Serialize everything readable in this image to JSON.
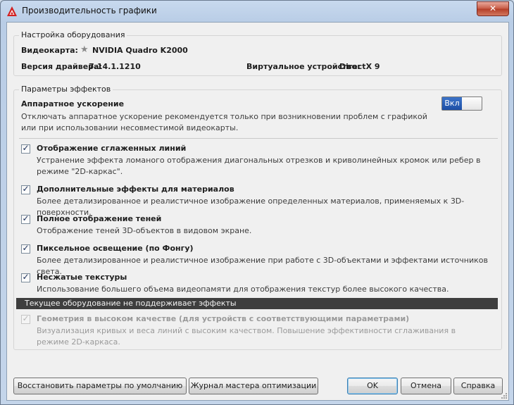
{
  "window": {
    "title": "Производительность графики",
    "close_label": "✕"
  },
  "hardware": {
    "legend": "Настройка оборудования",
    "card_label": "Видеокарта:",
    "card_value": "NVIDIA Quadro K2000",
    "driver_label": "Версия драйвера:",
    "driver_value": "7.14.1.1210",
    "device_label": "Виртуальное устройство:",
    "device_value": "DirectX 9"
  },
  "effects": {
    "legend": "Параметры эффектов",
    "hw_accel_title": "Аппаратное ускорение",
    "hw_accel_desc": "Отключать аппаратное ускорение рекомендуется только при возникновении проблем с графикой или при использовании несовместимой видеокарты.",
    "toggle_on_label": "Вкл",
    "options": [
      {
        "title": "Отображение сглаженных линий",
        "desc": "Устранение эффекта ломаного отображения диагональных отрезков и криволинейных кромок или ребер в режиме \"2D-каркас\".",
        "checked": true
      },
      {
        "title": "Дополнительные эффекты для материалов",
        "desc": "Более детализированное и реалистичное изображение определенных материалов, применяемых к 3D-поверхности.",
        "checked": true
      },
      {
        "title": "Полное отображение теней",
        "desc": "Отображение теней 3D-объектов в видовом экране.",
        "checked": true
      },
      {
        "title": "Пиксельное освещение (по Фонгу)",
        "desc": "Более детализированное и реалистичное изображение при работе с 3D-объектами и эффектами источников света.",
        "checked": true
      },
      {
        "title": "Несжатые текстуры",
        "desc": "Использование большего объема видеопамяти для отображения текстур более высокого качества.",
        "checked": true
      }
    ],
    "warning": "Текущее оборудование не поддерживает эффекты",
    "disabled_option": {
      "title": "Геометрия в высоком качестве (для устройств с соответствующими параметрами)",
      "desc": "Визуализация кривых и веса линий с высоким качеством. Повышение эффективности сглаживания в режиме 2D-каркаса.",
      "checked": true
    }
  },
  "buttons": {
    "restore": "Восстановить параметры по умолчанию",
    "wizard": "Журнал мастера оптимизации",
    "ok": "OK",
    "cancel": "Отмена",
    "help": "Справка"
  },
  "colors": {
    "toggle_on": "#1d4ea5",
    "warning_bar": "#3e3e3e",
    "close_button": "#c75a44",
    "app_icon": "#d22020"
  }
}
